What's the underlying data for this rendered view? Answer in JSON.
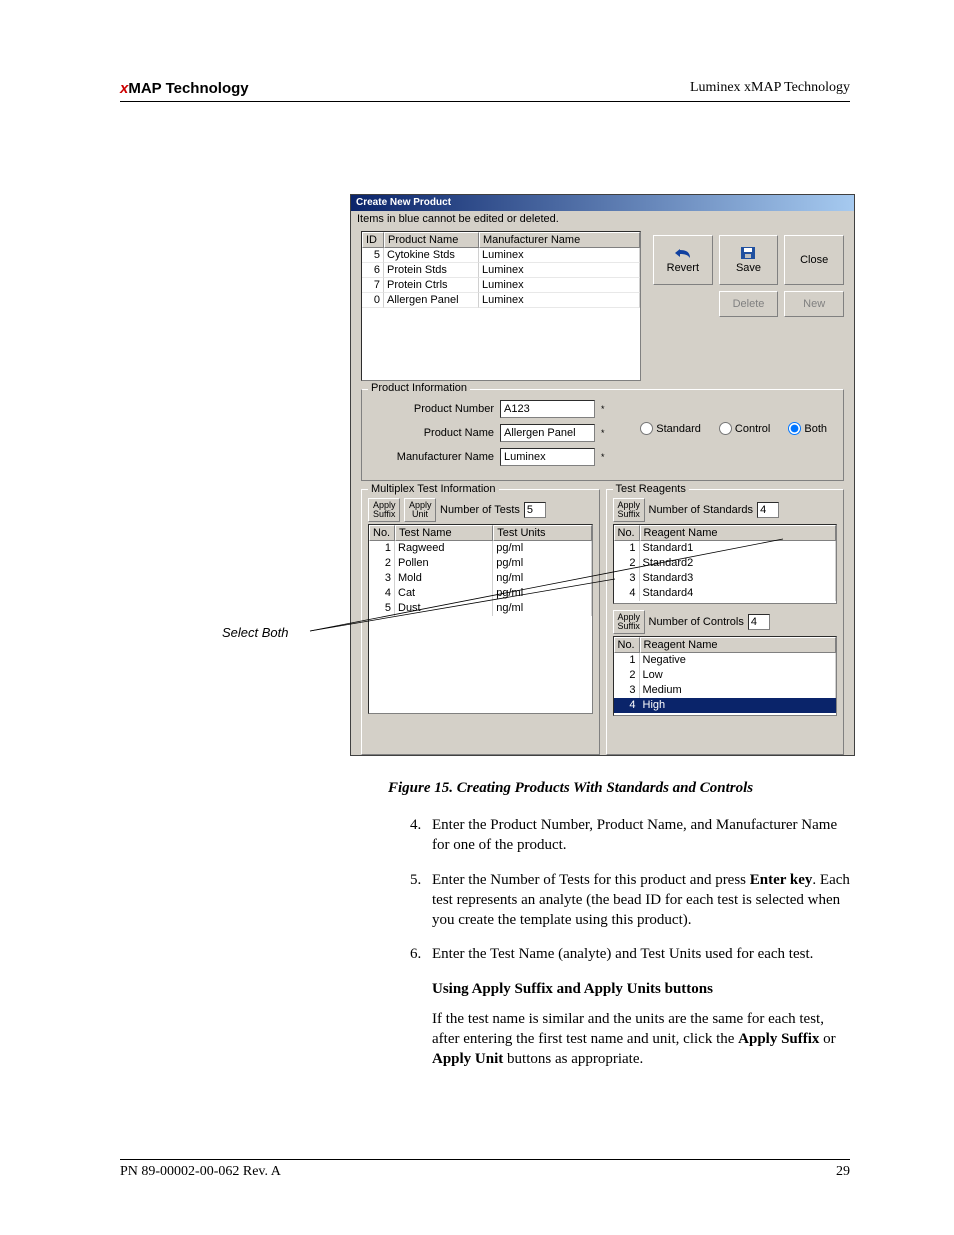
{
  "header": {
    "left_x": "x",
    "left_rest": "MAP Technology",
    "right": "Luminex xMAP Technology"
  },
  "footer": {
    "left": "PN 89-00002-00-062 Rev. A",
    "right": "29"
  },
  "callout": "Select Both",
  "caption": "Figure 15.  Creating Products With Standards and Controls",
  "steps": {
    "s4_num": "4.",
    "s4": "Enter the Product Number, Product Name, and Manufacturer Name for one of the product.",
    "s5_num": "5.",
    "s5a": "Enter the Number of Tests for this product and press ",
    "s5b": "Enter key",
    "s5c": ". Each test represents an analyte (the bead ID for each test is selected when you create the template using this product).",
    "s6_num": "6.",
    "s6": "Enter the Test Name (analyte) and Test Units used for each test."
  },
  "subhead": "Using Apply Suffix and Apply Units buttons",
  "subtext": {
    "a": "If the test name is similar and the units are the same for each test, after entering the first test name and unit, click the ",
    "b": "Apply Suffix",
    "c": " or ",
    "d": "Apply Unit",
    "e": " buttons as appropriate."
  },
  "dialog": {
    "title": "Create New Product",
    "note": "Items in blue cannot be edited or deleted.",
    "cols": {
      "id": "ID",
      "pname": "Product Name",
      "mname": "Manufacturer Name"
    },
    "rows": [
      {
        "id": "5",
        "pname": "Cytokine Stds",
        "mname": "Luminex"
      },
      {
        "id": "6",
        "pname": "Protein Stds",
        "mname": "Luminex"
      },
      {
        "id": "7",
        "pname": "Protein Ctrls",
        "mname": "Luminex"
      },
      {
        "id": "0",
        "pname": "Allergen Panel",
        "mname": "Luminex"
      }
    ],
    "buttons": {
      "revert": "Revert",
      "save": "Save",
      "close": "Close",
      "delete": "Delete",
      "new": "New"
    },
    "prodinfo": {
      "title": "Product Information",
      "pnum_l": "Product Number",
      "pnum_v": "A123",
      "pname_l": "Product Name",
      "pname_v": "Allergen Panel",
      "mname_l": "Manufacturer Name",
      "mname_v": "Luminex"
    },
    "radios": {
      "standard": "Standard",
      "control": "Control",
      "both": "Both"
    },
    "multi": {
      "title": "Multiplex Test Information",
      "apply_suffix": "Apply Suffix",
      "apply_unit": "Apply Unit",
      "ntests_l": "Number of Tests",
      "ntests_v": "5",
      "cols": {
        "no": "No.",
        "tname": "Test Name",
        "tunits": "Test Units"
      },
      "rows": [
        {
          "no": "1",
          "tname": "Ragweed",
          "tunits": "pg/ml"
        },
        {
          "no": "2",
          "tname": "Pollen",
          "tunits": "pg/ml"
        },
        {
          "no": "3",
          "tname": "Mold",
          "tunits": "ng/ml"
        },
        {
          "no": "4",
          "tname": "Cat",
          "tunits": "pg/ml"
        },
        {
          "no": "5",
          "tname": "Dust",
          "tunits": "ng/ml"
        }
      ]
    },
    "reag": {
      "title": "Test Reagents",
      "apply_suffix": "Apply Suffix",
      "nstd_l": "Number of Standards",
      "nstd_v": "4",
      "cols": {
        "no": "No.",
        "rname": "Reagent Name"
      },
      "std_rows": [
        {
          "no": "1",
          "rname": "Standard1"
        },
        {
          "no": "2",
          "rname": "Standard2"
        },
        {
          "no": "3",
          "rname": "Standard3"
        },
        {
          "no": "4",
          "rname": "Standard4"
        }
      ],
      "nctrl_l": "Number of Controls",
      "nctrl_v": "4",
      "ctrl_rows": [
        {
          "no": "1",
          "rname": "Negative"
        },
        {
          "no": "2",
          "rname": "Low"
        },
        {
          "no": "3",
          "rname": "Medium"
        },
        {
          "no": "4",
          "rname": "High"
        }
      ]
    }
  }
}
